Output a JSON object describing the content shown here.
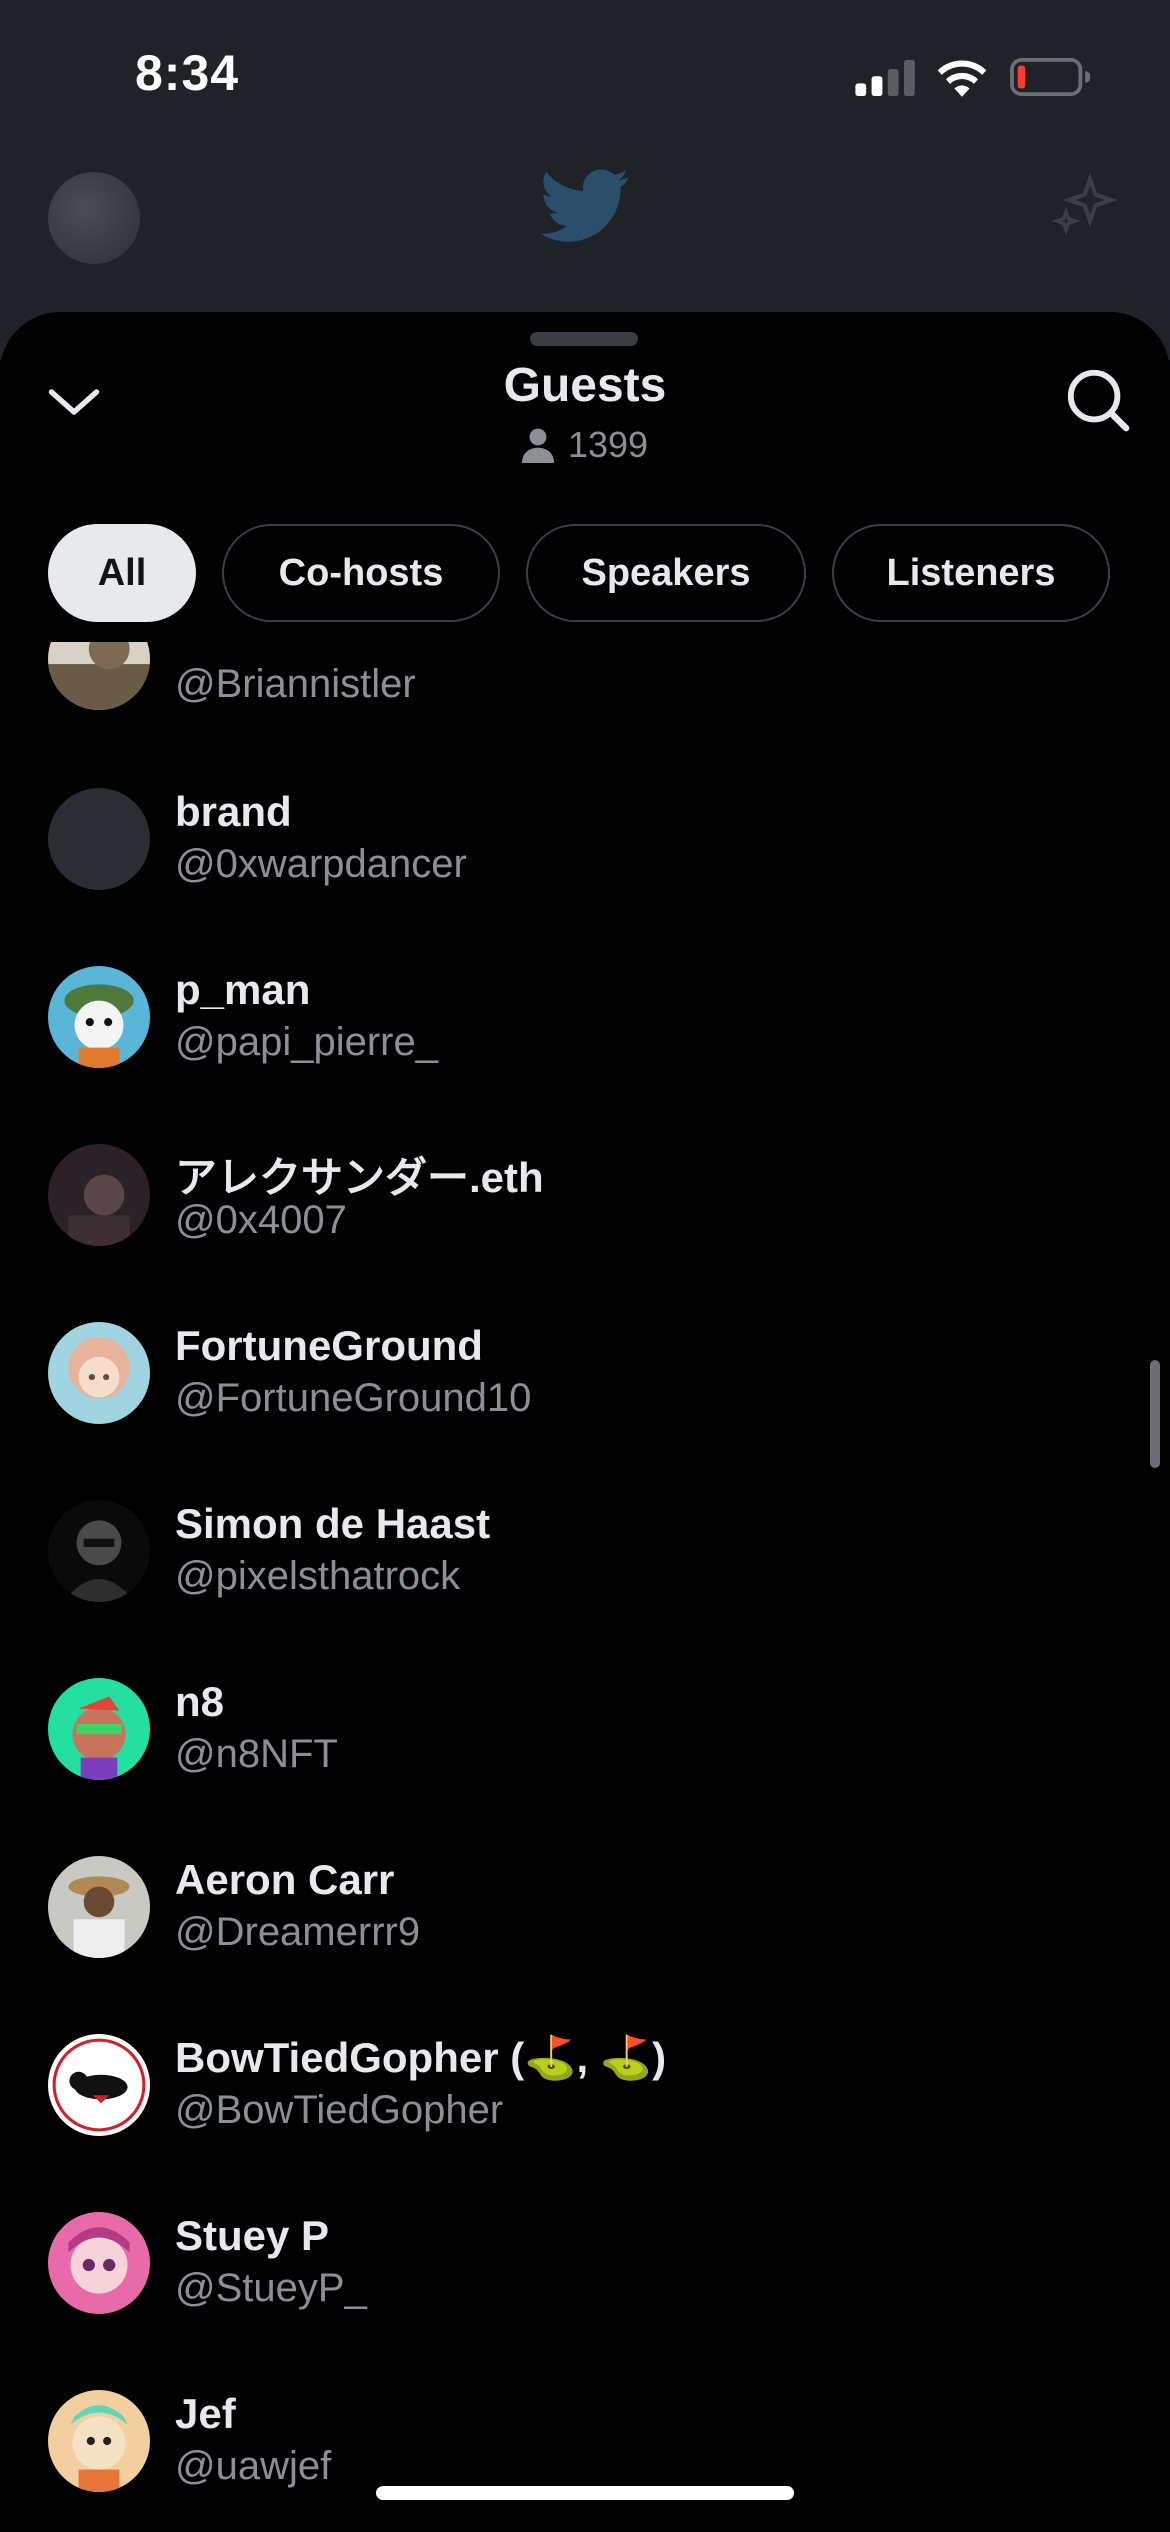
{
  "status_bar": {
    "time": "8:34"
  },
  "sheet": {
    "title": "Guests",
    "listener_count": "1399",
    "filters": [
      {
        "label": "All",
        "active": true
      },
      {
        "label": "Co-hosts",
        "active": false
      },
      {
        "label": "Speakers",
        "active": false
      },
      {
        "label": "Listeners",
        "active": false
      }
    ]
  },
  "guests": [
    {
      "name": "",
      "handle": "@Briannistler",
      "avatar": "hat-figure"
    },
    {
      "name": "brand",
      "handle": "@0xwarpdancer",
      "avatar": "blank-gray"
    },
    {
      "name": "p_man",
      "handle": "@papi_pierre_",
      "avatar": "green-cap-panda"
    },
    {
      "name": "アレクサンダー.eth",
      "handle": "@0x4007",
      "avatar": "dark-portrait"
    },
    {
      "name": "FortuneGround",
      "handle": "@FortuneGround10",
      "avatar": "anime-girl"
    },
    {
      "name": "Simon de Haast",
      "handle": "@pixelsthatrock",
      "avatar": "hooded-figure"
    },
    {
      "name": "n8",
      "handle": "@n8NFT",
      "avatar": "ape-green"
    },
    {
      "name": "Aeron Carr",
      "handle": "@Dreamerrr9",
      "avatar": "cowboy-hat-man"
    },
    {
      "name": "BowTiedGopher (⛳, ⛳)",
      "handle": "@BowTiedGopher",
      "avatar": "gopher-logo"
    },
    {
      "name": "Stuey P",
      "handle": "@StueyP_",
      "avatar": "pink-anime"
    },
    {
      "name": "Jef",
      "handle": "@uawjef",
      "avatar": "cartoon-character"
    }
  ],
  "colors": {
    "background": "#000000",
    "text": "#e7e9ea",
    "muted": "#8b9096",
    "chip_border": "#3b3f44"
  }
}
